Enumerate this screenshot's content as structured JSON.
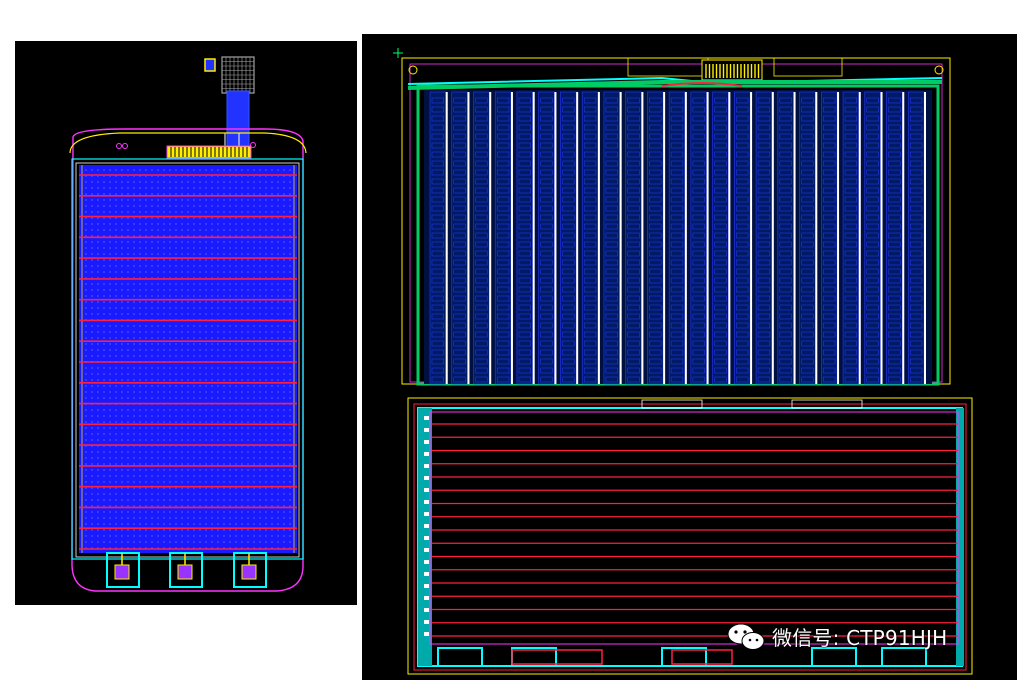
{
  "watermark": {
    "text": "微信号: CTP91HJH",
    "icon": "wechat-icon"
  },
  "panels": {
    "left": {
      "rows": 19,
      "fill_color": "#1a1aff",
      "line_color": "#ff2040"
    },
    "top_right": {
      "columns": 23,
      "fill_color": "#001a66",
      "line_color": "#ffffff"
    },
    "bottom_right": {
      "rows": 17,
      "fill_color": "#000000",
      "line_color": "#ff2040"
    }
  },
  "colors": {
    "background": "#000000",
    "outline_magenta": "#ff33ff",
    "outline_yellow": "#ffee00",
    "outline_cyan": "#00ffff",
    "outline_green": "#00cc66"
  }
}
